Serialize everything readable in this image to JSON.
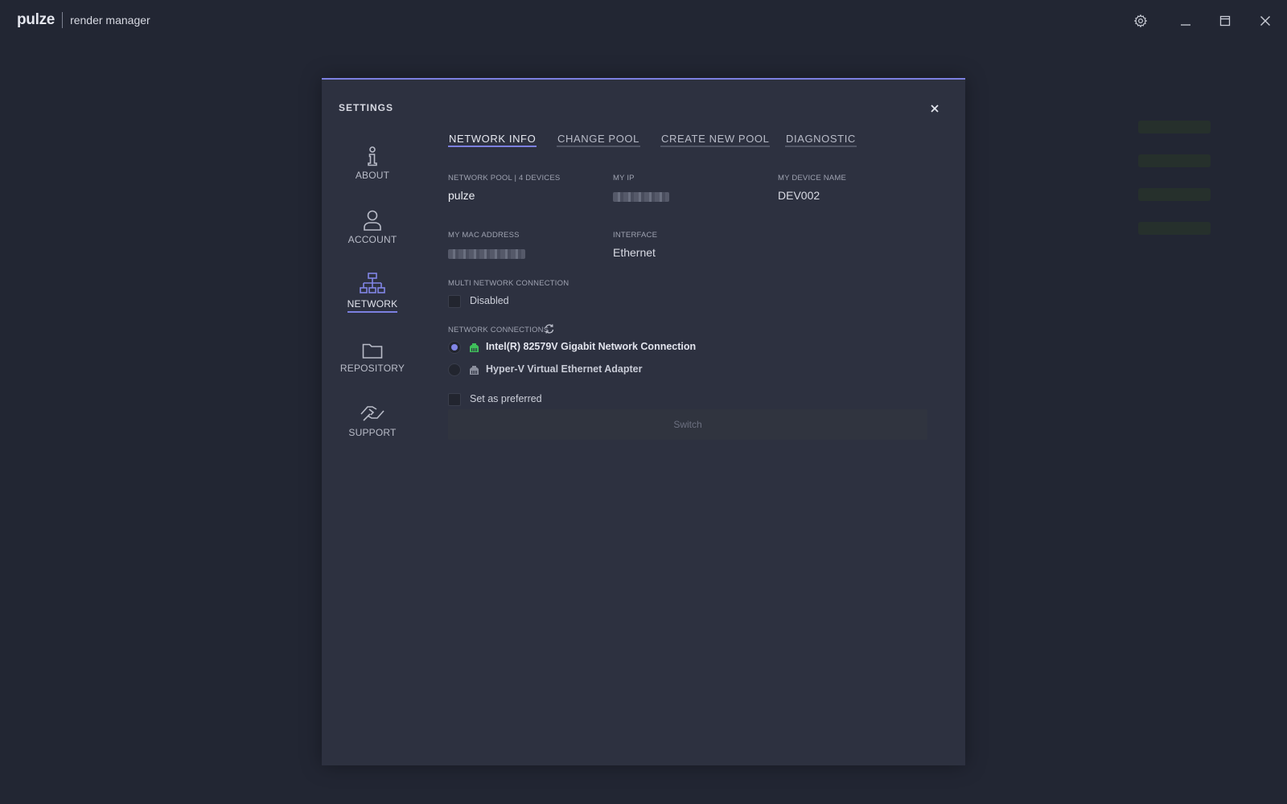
{
  "app": {
    "logo": "pulze",
    "subtitle": "render manager"
  },
  "modal": {
    "title": "SETTINGS"
  },
  "sidebar": {
    "items": [
      {
        "label": "ABOUT",
        "icon": "info-icon"
      },
      {
        "label": "ACCOUNT",
        "icon": "user-icon"
      },
      {
        "label": "NETWORK",
        "icon": "network-icon",
        "active": true
      },
      {
        "label": "REPOSITORY",
        "icon": "folder-icon"
      },
      {
        "label": "SUPPORT",
        "icon": "handshake-icon"
      }
    ]
  },
  "tabs": [
    {
      "label": "NETWORK INFO",
      "active": true
    },
    {
      "label": "CHANGE POOL"
    },
    {
      "label": "CREATE NEW POOL"
    },
    {
      "label": "DIAGNOSTIC"
    }
  ],
  "info": {
    "pool_label": "NETWORK POOL | 4 DEVICES",
    "pool_value": "pulze",
    "ip_label": "MY IP",
    "device_label": "MY DEVICE NAME",
    "device_value": "DEV002",
    "mac_label": "MY MAC ADDRESS",
    "interface_label": "INTERFACE",
    "interface_value": "Ethernet",
    "multi_label": "MULTI NETWORK CONNECTION",
    "multi_value": "Disabled",
    "connections_label": "NETWORK CONNECTIONS"
  },
  "connections": [
    {
      "label": "Intel(R) 82579V Gigabit Network Connection",
      "selected": true,
      "status_color": "#3fbf5a"
    },
    {
      "label": "Hyper-V Virtual Ethernet Adapter",
      "selected": false,
      "status_color": "#8a8e9c"
    }
  ],
  "preferred_label": "Set as preferred",
  "switch_label": "Switch",
  "colors": {
    "accent": "#7c80e0",
    "background": "#222633",
    "modal": "#2d3140"
  }
}
